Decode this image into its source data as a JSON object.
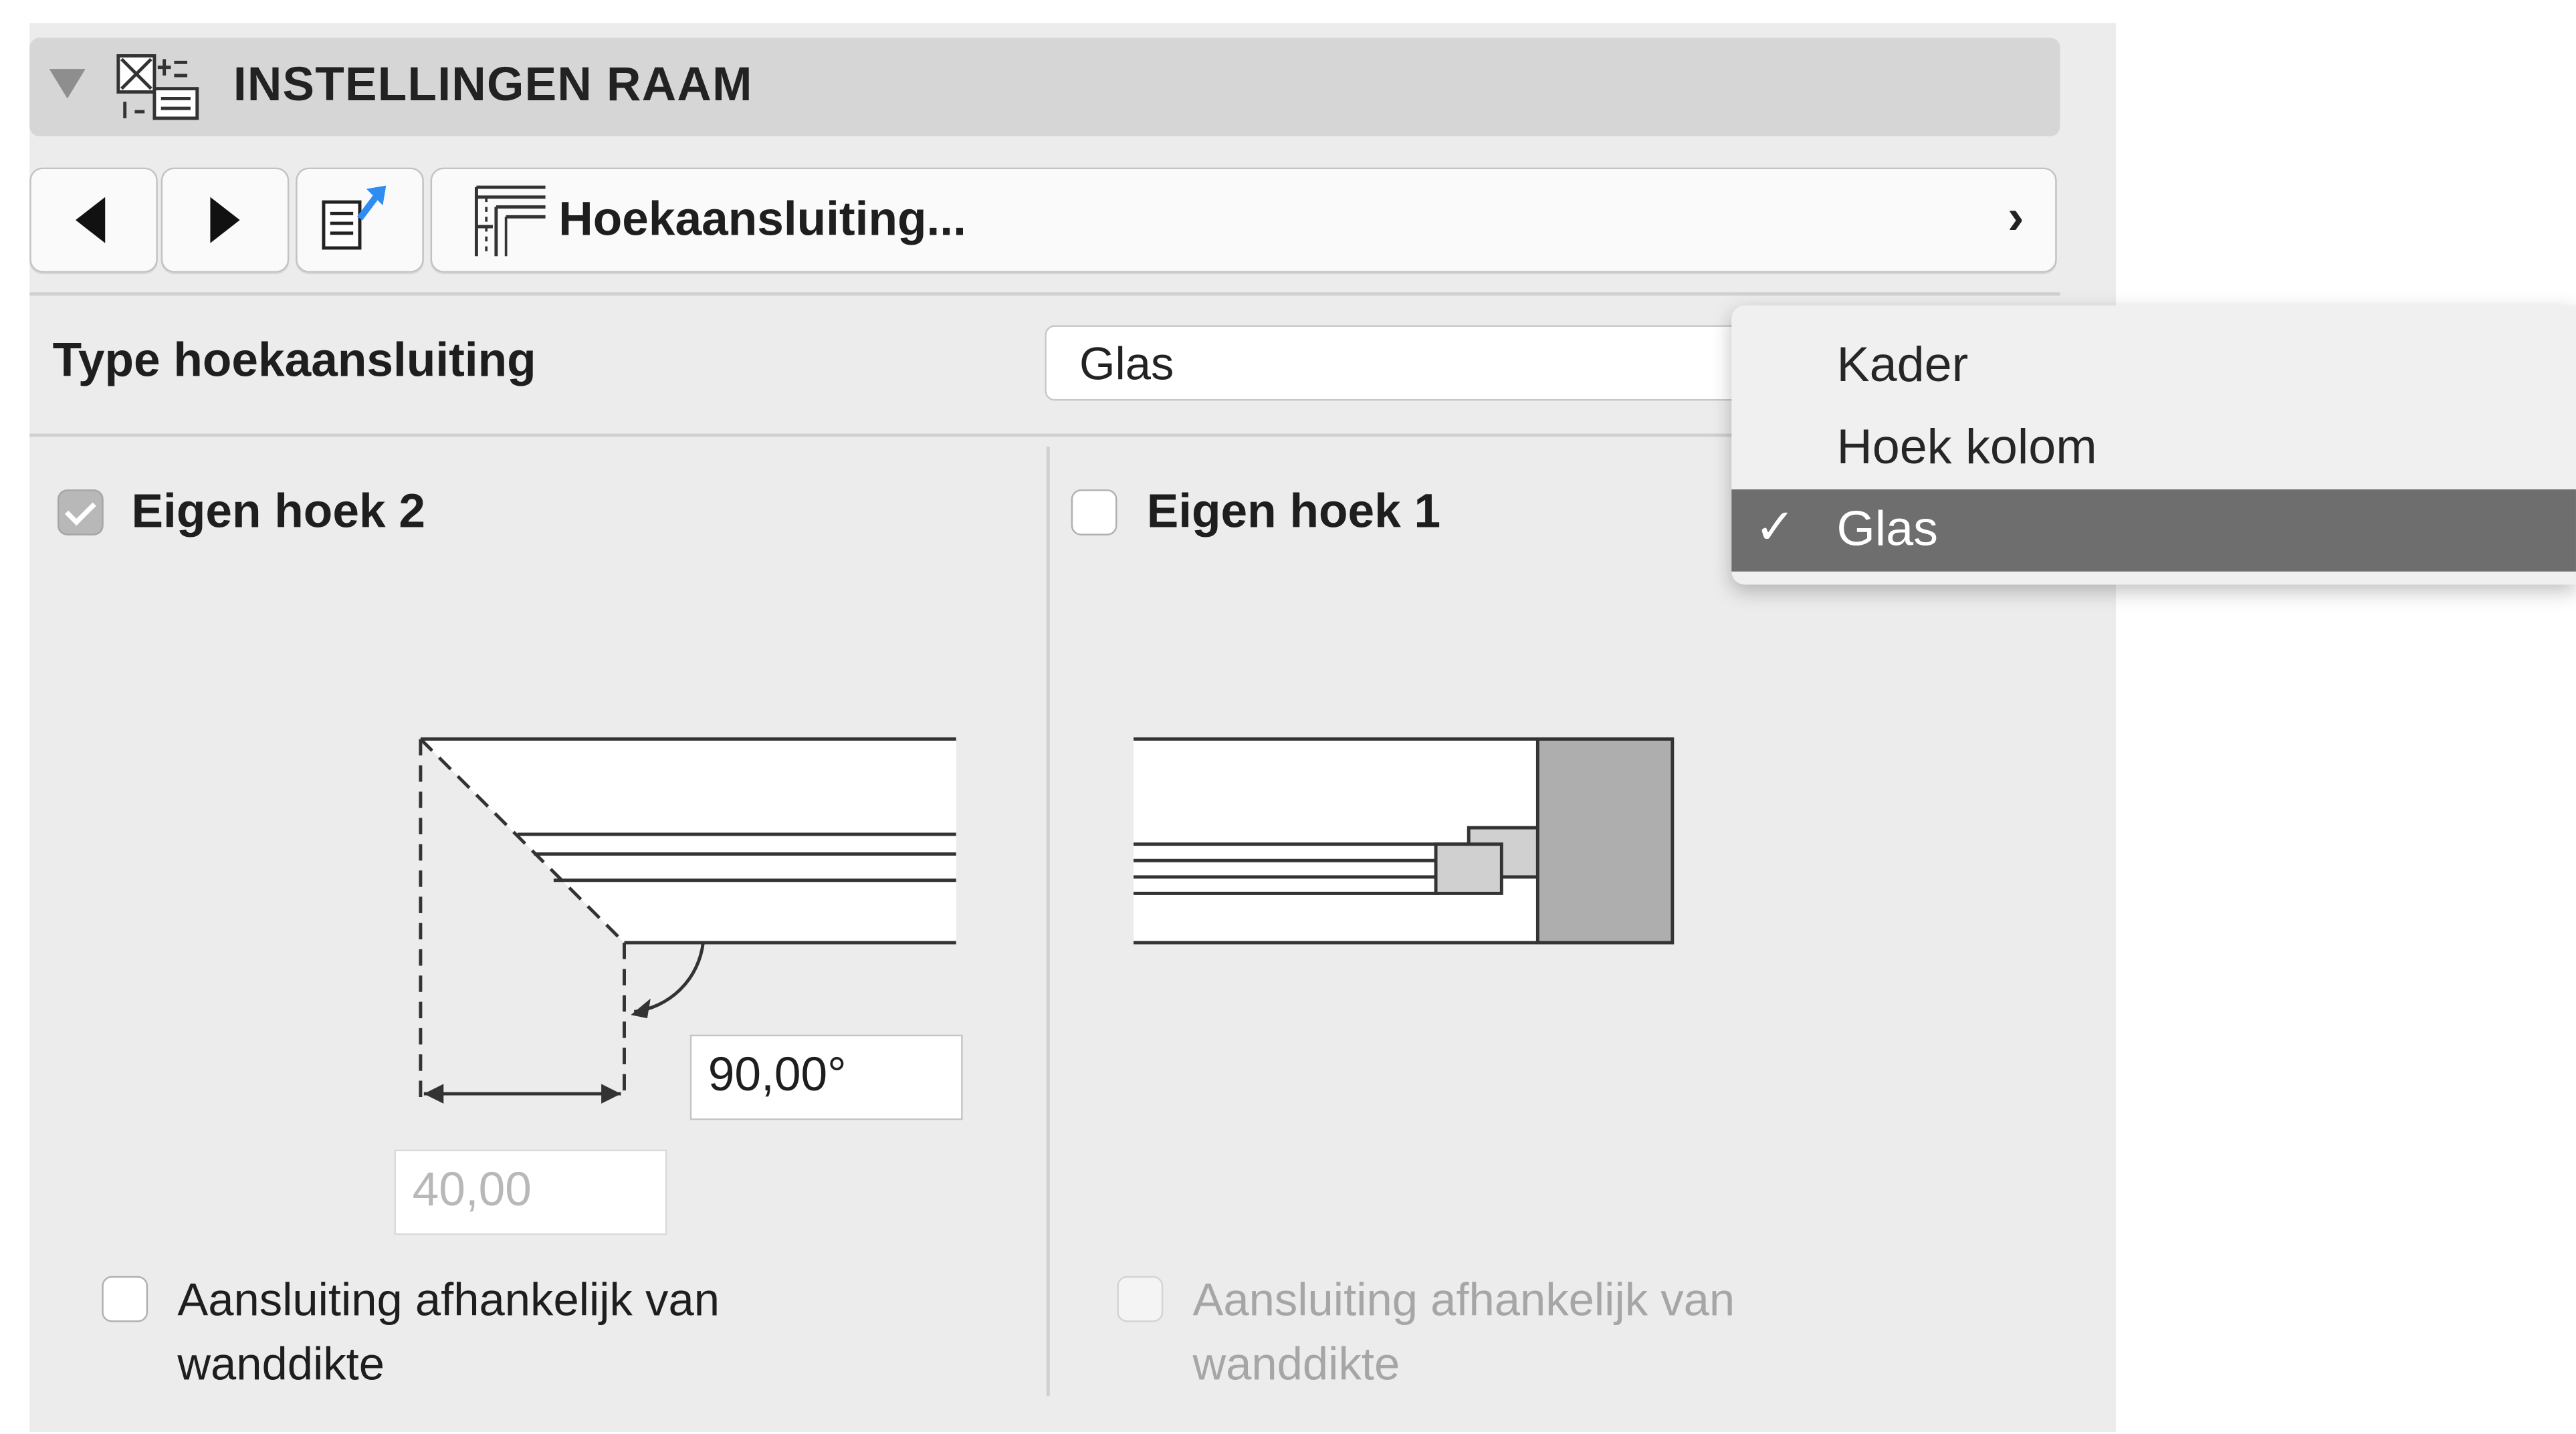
{
  "header": {
    "title": "INSTELLINGEN RAAM"
  },
  "nav": {
    "page_label": "Hoekaansluiting..."
  },
  "type_row": {
    "label": "Type hoekaansluiting",
    "selected_value": "Glas"
  },
  "dropdown": {
    "options": [
      {
        "label": "Kader",
        "selected": false
      },
      {
        "label": "Hoek kolom",
        "selected": false
      },
      {
        "label": "Glas",
        "selected": true
      }
    ],
    "check_glyph": "✓"
  },
  "left": {
    "checkbox_label": "Eigen hoek 2",
    "checked": true,
    "angle_value": "90,00°",
    "width_value": "40,00",
    "wall_checkbox_line1": "Aansluiting afhankelijk van",
    "wall_checkbox_line2": "wanddikte"
  },
  "right": {
    "checkbox_label": "Eigen hoek 1",
    "checked": false,
    "wall_checkbox_line1": "Aansluiting afhankelijk van",
    "wall_checkbox_line2": "wanddikte"
  },
  "colors": {
    "panel_bg": "#ececec",
    "header_bg": "#d6d6d6",
    "dropdown_selected": "#6e6e6e",
    "accent_blue": "#2f8cf0"
  },
  "icons": [
    "collapse-triangle-icon",
    "window-settings-icon",
    "prev-arrow-icon",
    "next-arrow-icon",
    "favorites-icon",
    "corner-join-icon",
    "chevron-right-icon",
    "checkmark-icon"
  ]
}
